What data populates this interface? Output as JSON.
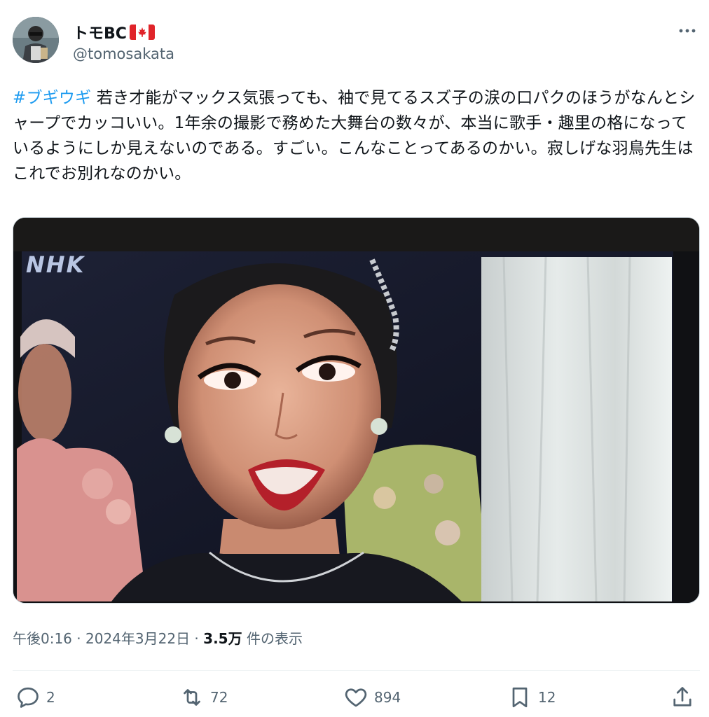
{
  "user": {
    "display_name": "トモBC",
    "flag": "canada-flag",
    "handle": "@tomosakata"
  },
  "tweet": {
    "hashtag": "#ブギウギ",
    "body": " 若き才能がマックス気張っても、袖で見てるスズ子の涙の口パクのほうがなんとシャープでカッコいい。1年余の撮影で務めた大舞台の数々が、本当に歌手・趣里の格になっているようにしか見えないのである。すごい。こんなことってあるのかい。寂しげな羽鳥先生はこれでお別れなのかい。",
    "media": {
      "type": "photo",
      "overlay_text": "NHK"
    }
  },
  "meta": {
    "time": "午後0:16",
    "separator": " · ",
    "date": "2024年3月22日",
    "views_count": "3.5万",
    "views_label": " 件の表示"
  },
  "actions": {
    "replies": "2",
    "reposts": "72",
    "likes": "894",
    "bookmarks": "12"
  },
  "icons": [
    "more-icon",
    "reply-icon",
    "repost-icon",
    "like-icon",
    "bookmark-icon",
    "share-icon"
  ],
  "colors": {
    "accent": "#1d9bf0",
    "secondary": "#536471",
    "text": "#0f1419"
  }
}
